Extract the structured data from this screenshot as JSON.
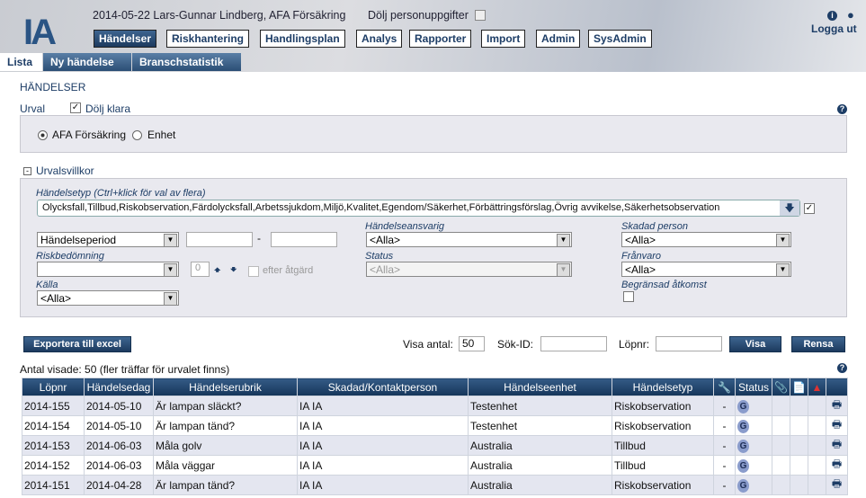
{
  "header": {
    "logo": "IA",
    "user_line": "2014-05-22 Lars-Gunnar Lindberg, AFA Försäkring",
    "hide_personal": "Dölj personuppgifter",
    "logout": "Logga ut"
  },
  "nav": [
    "Händelser",
    "Riskhantering",
    "Handlingsplan",
    "Analys",
    "Rapporter",
    "Import",
    "Admin",
    "SysAdmin"
  ],
  "tabs": [
    "Lista",
    "Ny händelse",
    "Branschstatistik"
  ],
  "page_title": "HÄNDELSER",
  "urval": {
    "label": "Urval",
    "hide_done": "Dölj klara",
    "radio1": "AFA Försäkring",
    "radio2": "Enhet"
  },
  "filters": {
    "section": "Urvalsvillkor",
    "type_label": "Händelsetyp (Ctrl+klick för val av flera)",
    "type_value": "Olycksfall,Tillbud,Riskobservation,Färdolycksfall,Arbetssjukdom,Miljö,Kvalitet,Egendom/Säkerhet,Förbättringsförslag,Övrig avvikelse,Säkerhetsobservation",
    "period": "Händelseperiod",
    "dash": "-",
    "risk_label": "Riskbedömning",
    "risk_num": "0",
    "after_action": "efter åtgärd",
    "source_label": "Källa",
    "source_value": "<Alla>",
    "responsible_label": "Händelseansvarig",
    "responsible_value": "<Alla>",
    "status_label": "Status",
    "status_value": "<Alla>",
    "injured_label": "Skadad person",
    "injured_value": "<Alla>",
    "absence_label": "Frånvaro",
    "absence_value": "<Alla>",
    "restricted_label": "Begränsad åtkomst"
  },
  "toolbar": {
    "export": "Exportera till excel",
    "show_count_label": "Visa antal:",
    "show_count": "50",
    "search_id_label": "Sök-ID:",
    "lopnr_label": "Löpnr:",
    "show": "Visa",
    "clear": "Rensa"
  },
  "count_text": "Antal visade: 50 (fler träffar för urvalet finns)",
  "table": {
    "headers": [
      "Löpnr",
      "Händelsedag",
      "Händelserubrik",
      "Skadad/Kontaktperson",
      "Händelseenhet",
      "Händelsetyp",
      "",
      "Status",
      "",
      "",
      "",
      ""
    ],
    "rows": [
      [
        "2014-155",
        "2014-05-10",
        "Är lampan släckt?",
        "IA IA",
        "Testenhet",
        "Riskobservation",
        "-",
        "G"
      ],
      [
        "2014-154",
        "2014-05-10",
        "Är lampan tänd?",
        "IA IA",
        "Testenhet",
        "Riskobservation",
        "-",
        "G"
      ],
      [
        "2014-153",
        "2014-06-03",
        "Måla golv",
        "IA IA",
        "Australia",
        "Tillbud",
        "-",
        "G"
      ],
      [
        "2014-152",
        "2014-06-03",
        "Måla väggar",
        "IA IA",
        "Australia",
        "Tillbud",
        "-",
        "G"
      ],
      [
        "2014-151",
        "2014-04-28",
        "Är lampan tänd?",
        "IA IA",
        "Australia",
        "Riskobservation",
        "-",
        "G"
      ]
    ]
  }
}
